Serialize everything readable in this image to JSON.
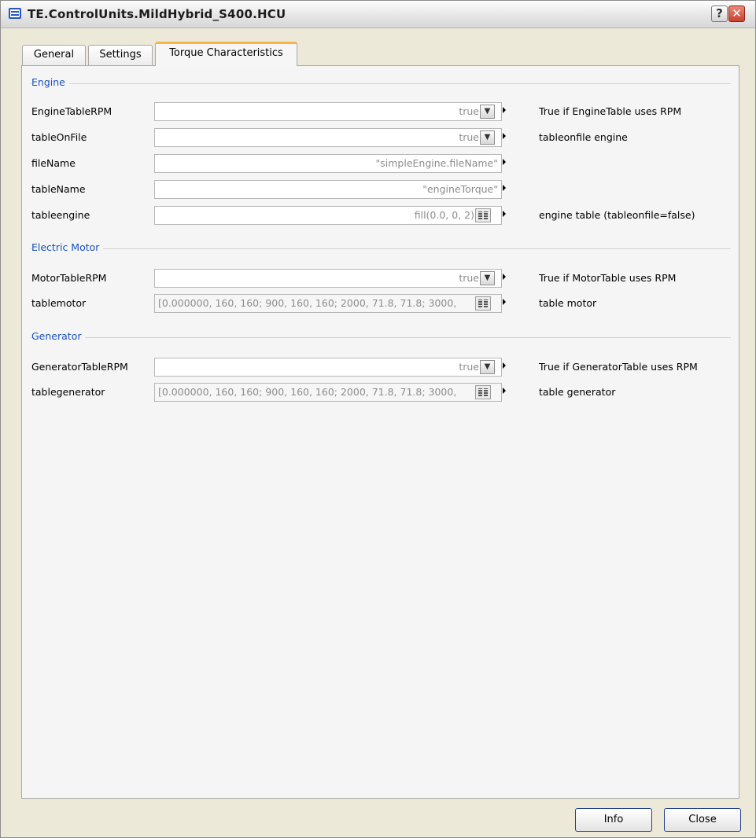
{
  "window": {
    "title": "TE.ControlUnits.MildHybrid_S400.HCU",
    "help_label": "?",
    "close_label": "✕"
  },
  "tabs": [
    {
      "label": "General"
    },
    {
      "label": "Settings"
    },
    {
      "label": "Torque Characteristics"
    }
  ],
  "groups": {
    "engine": {
      "label": "Engine",
      "rows": [
        {
          "name": "EngineTableRPM",
          "value": "true",
          "description": "True if EngineTable uses RPM"
        },
        {
          "name": "tableOnFile",
          "value": "true",
          "description": "tableonfile engine"
        },
        {
          "name": "fileName",
          "value": "\"simpleEngine.fileName\"",
          "description": ""
        },
        {
          "name": "tableName",
          "value": "\"engineTorque\"",
          "description": ""
        },
        {
          "name": "tableengine",
          "value": "fill(0.0, 0, 2)",
          "description": "engine table (tableonfile=false)"
        }
      ]
    },
    "motor": {
      "label": "Electric Motor",
      "rows": [
        {
          "name": "MotorTableRPM",
          "value": "true",
          "description": "True if MotorTable uses RPM"
        },
        {
          "name": "tablemotor",
          "value": "[0.000000, 160, 160; 900, 160, 160; 2000, 71.8, 71.8; 3000,",
          "description": "table motor"
        }
      ]
    },
    "generator": {
      "label": "Generator",
      "rows": [
        {
          "name": "GeneratorTableRPM",
          "value": "true",
          "description": "True if GeneratorTable uses RPM"
        },
        {
          "name": "tablegenerator",
          "value": "[0.000000, 160, 160; 900, 160, 160; 2000, 71.8, 71.8; 3000,",
          "description": "table generator"
        }
      ]
    }
  },
  "footer": {
    "info_label": "Info",
    "close_label": "Close"
  }
}
